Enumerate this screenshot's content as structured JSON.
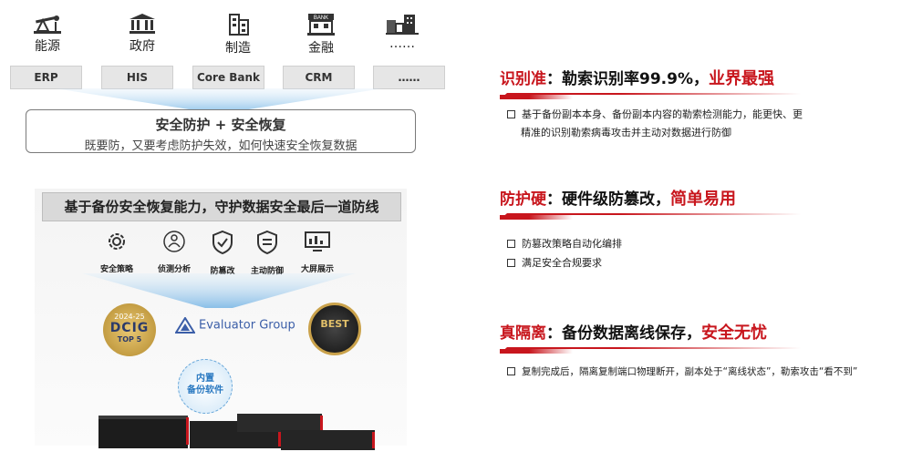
{
  "industries": [
    {
      "label": "能源",
      "icon": "oil-pump-icon"
    },
    {
      "label": "政府",
      "icon": "government-building-icon"
    },
    {
      "label": "制造",
      "icon": "factory-icon"
    },
    {
      "label": "金融",
      "icon": "bank-icon"
    },
    {
      "label": "……",
      "icon": "city-buildings-icon"
    }
  ],
  "bank_sign": "BANK",
  "systems": [
    "ERP",
    "HIS",
    "Core Bank",
    "CRM",
    "……"
  ],
  "security": {
    "title": "安全防护 + 安全恢复",
    "subtitle": "既要防，又要考虑防护失效，如何快速安全恢复数据"
  },
  "panel": {
    "heading": "基于备份安全恢复能力，守护数据安全最后一道防线",
    "features": [
      {
        "label": "安全策略",
        "icon": "gear-icon"
      },
      {
        "label": "侦测分析",
        "icon": "detection-analysis-icon"
      },
      {
        "label": "防篡改",
        "icon": "shield-icon"
      },
      {
        "label": "主动防御",
        "icon": "active-defense-shield-icon"
      },
      {
        "label": "大屏展示",
        "icon": "monitor-dashboard-icon"
      }
    ]
  },
  "badges": {
    "dcig_year": "2024-25",
    "dcig_name": "DCIG",
    "dcig_rank": "TOP 5",
    "evaluator": "Evaluator Group",
    "best": "BEST",
    "builtin_line1": "内置",
    "builtin_line2": "备份软件"
  },
  "points": [
    {
      "key": "识别准",
      "text": "：勒索识别率99.9%，",
      "emphasis": "业界最强",
      "bullets": [
        "基于备份副本本身、备份副本内容的勒索检测能力，能更快、更",
        "精准的识别勒索病毒攻击并主动对数据进行防御"
      ]
    },
    {
      "key": "防护硬",
      "text": "：硬件级防篡改，",
      "emphasis": "简单易用",
      "bullets": [
        "防篡改策略自动化编排",
        "满足安全合规要求"
      ]
    },
    {
      "key": "真隔离",
      "text": "：备份数据离线保存，",
      "emphasis": "安全无忧",
      "bullets": [
        "复制完成后，隔离复制端口物理断开，副本处于“离线状态”，勒索攻击“看不到”"
      ]
    }
  ],
  "colors": {
    "accent": "#c8161d",
    "panel_head": "#d9d9d9",
    "globe": "#2a79c1"
  }
}
